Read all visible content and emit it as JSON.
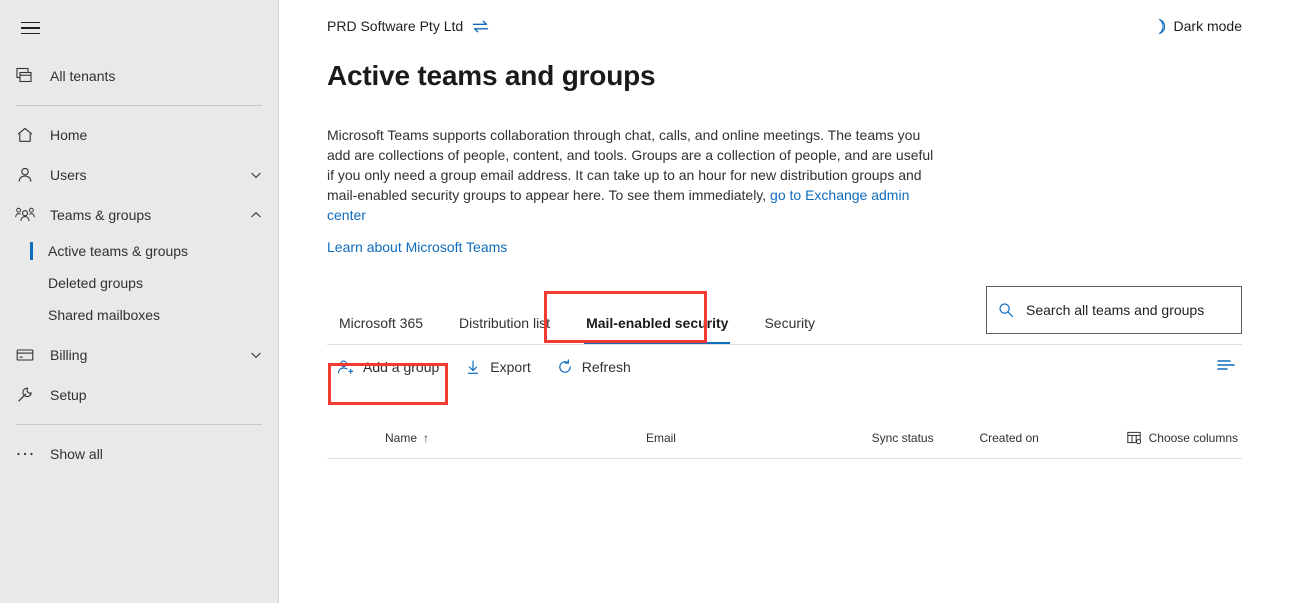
{
  "sidebar": {
    "menu_button": "menu-icon",
    "tenants": {
      "label": "All tenants",
      "icon": "tenants-icon"
    },
    "items": [
      {
        "label": "Home",
        "icon": "home-icon",
        "expandable": false
      },
      {
        "label": "Users",
        "icon": "user-icon",
        "expandable": true,
        "chevron": "chevron-down-icon"
      },
      {
        "label": "Teams & groups",
        "icon": "people-icon",
        "expandable": true,
        "chevron": "chevron-up-icon"
      }
    ],
    "subitems": [
      {
        "label": "Active teams & groups",
        "active": true
      },
      {
        "label": "Deleted groups",
        "active": false
      },
      {
        "label": "Shared mailboxes",
        "active": false
      }
    ],
    "items_lower": [
      {
        "label": "Billing",
        "icon": "credit-card-icon",
        "expandable": true,
        "chevron": "chevron-down-icon"
      },
      {
        "label": "Setup",
        "icon": "wrench-icon",
        "expandable": false
      }
    ],
    "show_all": {
      "label": "Show all",
      "icon": "ellipsis-icon"
    }
  },
  "header": {
    "tenant_name": "PRD Software Pty Ltd",
    "switch_icon": "switch-tenant-icon",
    "dark_mode_label": "Dark mode",
    "dark_mode_icon": "moon-icon"
  },
  "page": {
    "title": "Active teams and groups",
    "description_part1": "Microsoft Teams supports collaboration through chat, calls, and online meetings. The teams you add are collections of people, content, and tools. Groups are a collection of people, and are useful if you only need a group email address. It can take up to an hour for new distribution groups and mail-enabled security groups to appear here. To see them immediately, ",
    "description_link": "go to Exchange admin center",
    "learn_link": "Learn about Microsoft Teams"
  },
  "tabs": [
    {
      "label": "Microsoft 365",
      "active": false
    },
    {
      "label": "Distribution list",
      "active": false
    },
    {
      "label": "Mail-enabled security",
      "active": true
    },
    {
      "label": "Security",
      "active": false
    }
  ],
  "search": {
    "placeholder": "Search all teams and groups",
    "value": "",
    "icon": "search-icon"
  },
  "toolbar": {
    "add_group_label": "Add a group",
    "add_group_icon": "add-user-icon",
    "export_label": "Export",
    "export_icon": "download-icon",
    "refresh_label": "Refresh",
    "refresh_icon": "refresh-icon",
    "filter_icon": "filter-icon"
  },
  "table": {
    "columns": [
      {
        "label": "Name",
        "sort": "↑"
      },
      {
        "label": "Email",
        "sort": ""
      },
      {
        "label": "Sync status",
        "sort": ""
      },
      {
        "label": "Created on",
        "sort": ""
      }
    ],
    "choose_columns_label": "Choose columns",
    "choose_columns_icon": "columns-icon",
    "rows": []
  },
  "colors": {
    "accent": "#0f6cbd",
    "annotation": "#f03a32",
    "sidebar_bg": "#e9e9e9",
    "text": "#323130"
  }
}
